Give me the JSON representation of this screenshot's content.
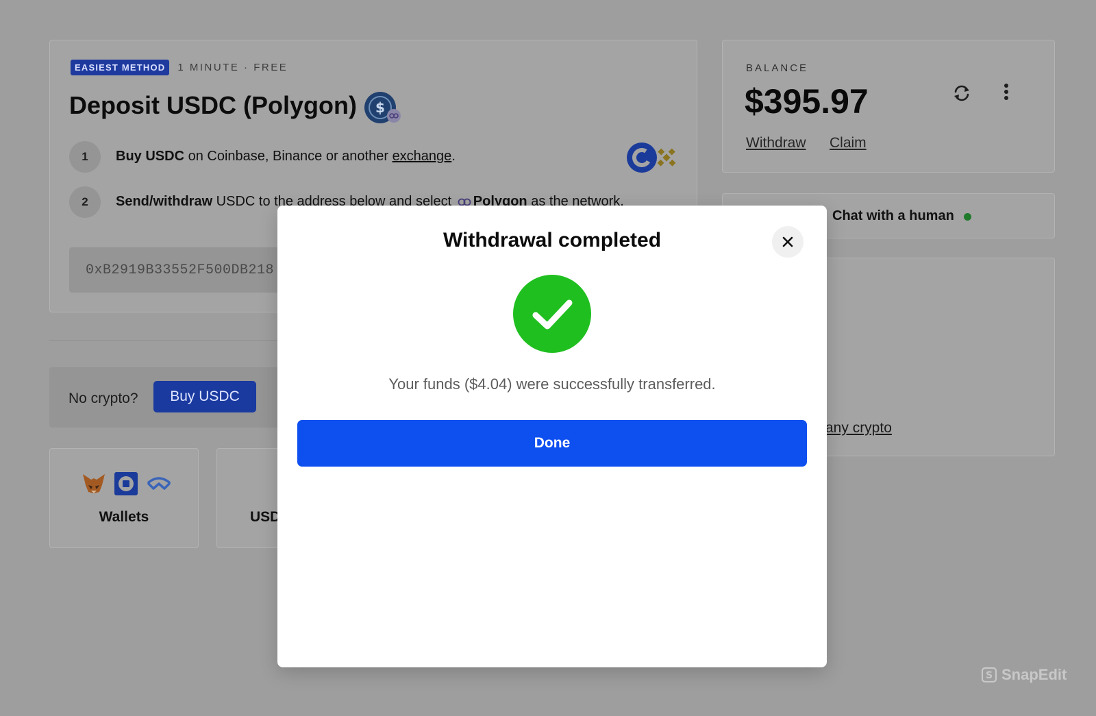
{
  "deposit": {
    "badge": "EASIEST METHOD",
    "meta": "1 MINUTE · FREE",
    "title": "Deposit USDC (Polygon)",
    "step1": {
      "number": "1",
      "bold": "Buy USDC",
      "text": " on Coinbase, Binance or another ",
      "link": "exchange",
      "end": "."
    },
    "step2": {
      "number": "2",
      "bold": "Send/withdraw",
      "text": " USDC to the address below and select ",
      "network": "Polygon",
      "end": " as the network."
    },
    "address": "0xB2919B33552F500DB218"
  },
  "no_crypto": {
    "label": "No crypto?",
    "button": "Buy USDC"
  },
  "tiles": {
    "wallets": "Wallets",
    "usdc": "USD"
  },
  "balance": {
    "label": "BALANCE",
    "value": "$395.97",
    "withdraw": "Withdraw",
    "claim": "Claim"
  },
  "chat": {
    "label": "Chat with a human"
  },
  "side": {
    "any_crypto": "any crypto"
  },
  "modal": {
    "title": "Withdrawal completed",
    "message": "Your funds ($4.04) were successfully transferred.",
    "done": "Done",
    "close_icon": "close-icon",
    "status_icon": "check-circle-icon"
  },
  "watermark": "SnapEdit",
  "colors": {
    "primary_button": "#0e4ff0",
    "success": "#1fbf1f",
    "badge": "#1e3a9e"
  }
}
